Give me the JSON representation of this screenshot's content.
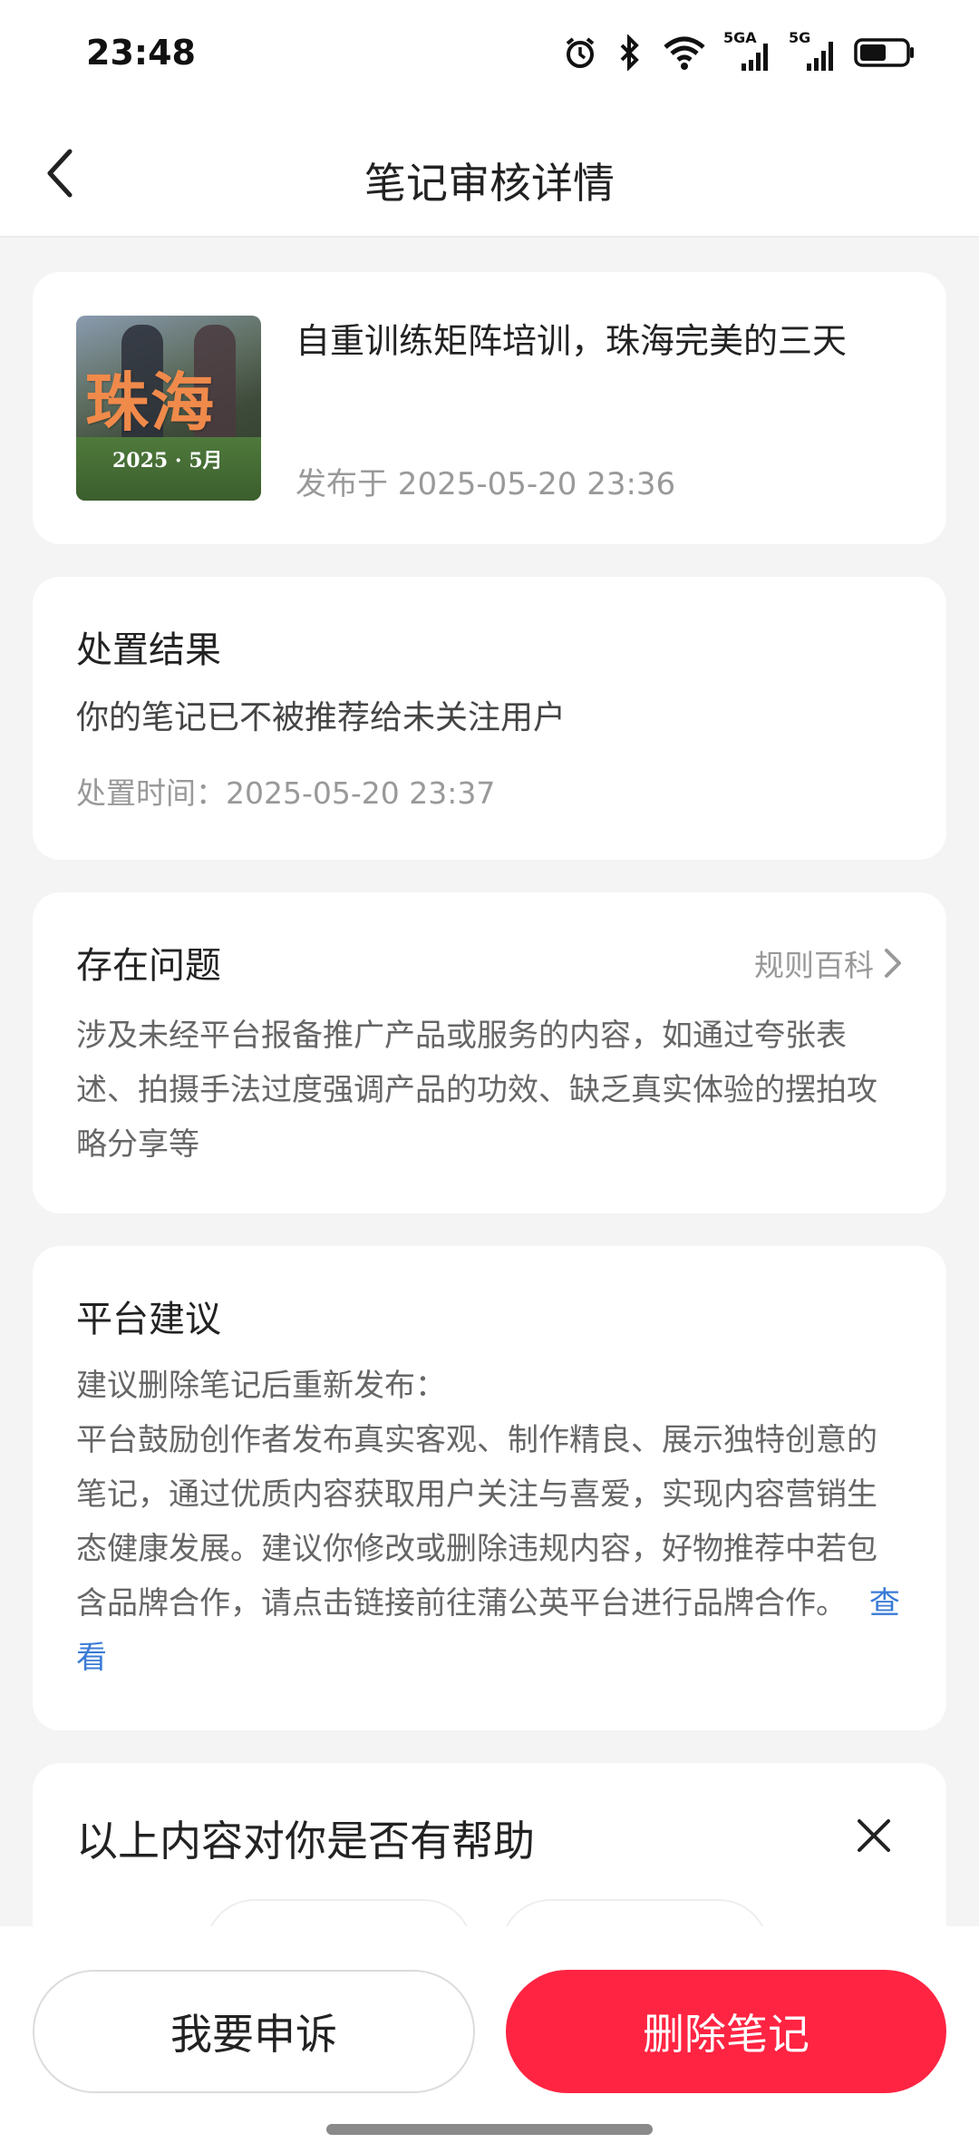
{
  "status_bar": {
    "time": "23:48",
    "icons": [
      "alarm-icon",
      "bluetooth-icon",
      "wifi-icon",
      "signal-5ga-icon",
      "signal-5g-icon",
      "battery-icon"
    ],
    "network_labels": [
      "5GA",
      "5G"
    ]
  },
  "header": {
    "title": "笔记审核详情",
    "back_icon": "chevron-left-icon"
  },
  "note": {
    "thumbnail_title": "珠海",
    "thumbnail_date": "2025 · 5月",
    "title": "自重训练矩阵培训，珠海完美的三天",
    "published": "发布于 2025-05-20 23:36"
  },
  "result": {
    "heading": "处置结果",
    "text": "你的笔记已不被推荐给未关注用户",
    "time": "处置时间：2025-05-20 23:37"
  },
  "issue": {
    "heading": "存在问题",
    "rule_link": "规则百科",
    "text": "涉及未经平台报备推广产品或服务的内容，如通过夸张表述、拍摄手法过度强调产品的功效、缺乏真实体验的摆拍攻略分享等"
  },
  "advice": {
    "heading": "平台建议",
    "line1": "建议删除笔记后重新发布：",
    "body": "平台鼓励创作者发布真实客观、制作精良、展示独特创意的笔记，通过优质内容获取用户关注与喜爱，实现内容营销生态健康发展。建议你修改或删除违规内容，好物推荐中若包含品牌合作，请点击链接前往蒲公英平台进行品牌合作。",
    "link": "查看"
  },
  "feedback": {
    "question": "以上内容对你是否有帮助"
  },
  "actions": {
    "appeal": "我要申诉",
    "delete": "删除笔记"
  },
  "colors": {
    "accent": "#ff2442",
    "link": "#3a7bd5",
    "background": "#f4f4f4"
  }
}
